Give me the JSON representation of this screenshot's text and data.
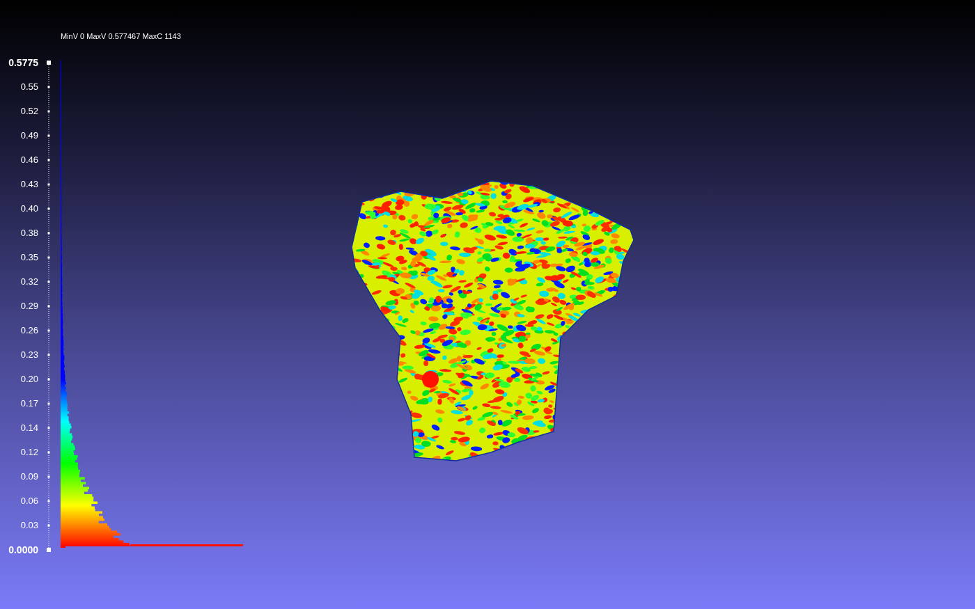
{
  "viewer": {
    "info_text": "MinV 0 MaxV 0.577467 MaxC 1143"
  },
  "colorbar": {
    "labels": [
      {
        "text": "0.5775",
        "kind": "end"
      },
      {
        "text": "0.55",
        "kind": "tick"
      },
      {
        "text": "0.52",
        "kind": "tick"
      },
      {
        "text": "0.49",
        "kind": "tick"
      },
      {
        "text": "0.46",
        "kind": "tick"
      },
      {
        "text": "0.43",
        "kind": "tick"
      },
      {
        "text": "0.40",
        "kind": "tick"
      },
      {
        "text": "0.38",
        "kind": "tick"
      },
      {
        "text": "0.35",
        "kind": "tick"
      },
      {
        "text": "0.32",
        "kind": "tick"
      },
      {
        "text": "0.29",
        "kind": "tick"
      },
      {
        "text": "0.26",
        "kind": "tick"
      },
      {
        "text": "0.23",
        "kind": "tick"
      },
      {
        "text": "0.20",
        "kind": "tick"
      },
      {
        "text": "0.17",
        "kind": "tick"
      },
      {
        "text": "0.14",
        "kind": "tick"
      },
      {
        "text": "0.12",
        "kind": "tick"
      },
      {
        "text": "0.09",
        "kind": "tick"
      },
      {
        "text": "0.06",
        "kind": "tick"
      },
      {
        "text": "0.03",
        "kind": "tick"
      },
      {
        "text": "0.0000",
        "kind": "end"
      }
    ]
  }
}
